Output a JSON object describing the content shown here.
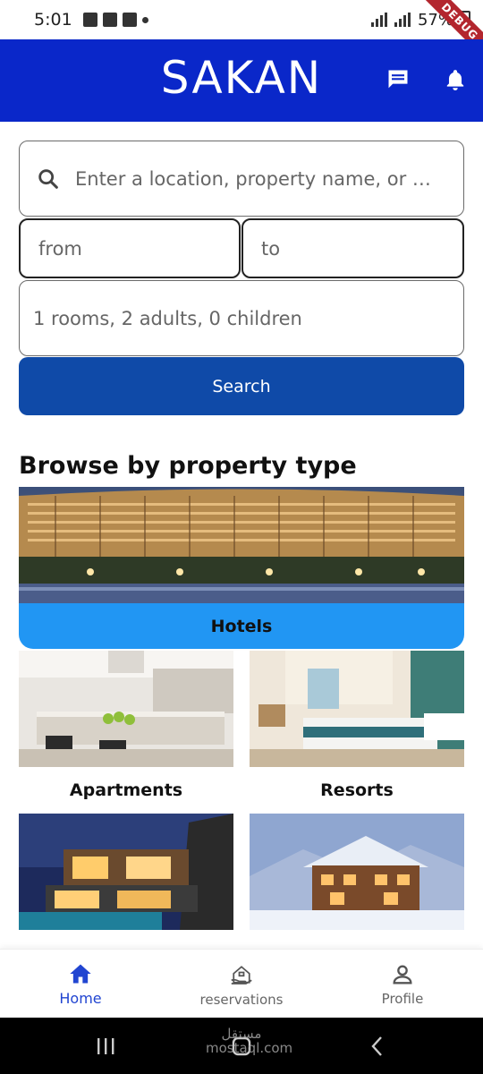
{
  "status_bar": {
    "time": "5:01",
    "battery": "57%",
    "debug_label": "DEBUG"
  },
  "app_bar": {
    "title": "SAKAN",
    "background_color": "#0a27c9",
    "icons": [
      "chat-icon",
      "bell-icon"
    ]
  },
  "search_form": {
    "location_placeholder": "Enter a location, property name, or a…",
    "from_placeholder": "from",
    "to_placeholder": "to",
    "guests_value": "1 rooms, 2 adults, 0 children",
    "search_label": "Search",
    "button_color": "#0f4aa8"
  },
  "browse": {
    "title": "Browse by property type",
    "types": [
      {
        "label": "Hotels"
      },
      {
        "label": "Apartments"
      },
      {
        "label": "Resorts"
      },
      {
        "label": ""
      },
      {
        "label": ""
      }
    ],
    "highlight_color": "#2196f3"
  },
  "bottom_nav": {
    "items": [
      {
        "label": "Home",
        "icon": "home-icon",
        "active": true
      },
      {
        "label": "reservations",
        "icon": "reservations-icon",
        "active": false
      },
      {
        "label": "Profile",
        "icon": "person-icon",
        "active": false
      }
    ],
    "active_color": "#2145d1"
  },
  "system_nav": {
    "watermark": "مستقل mostaql.com"
  }
}
